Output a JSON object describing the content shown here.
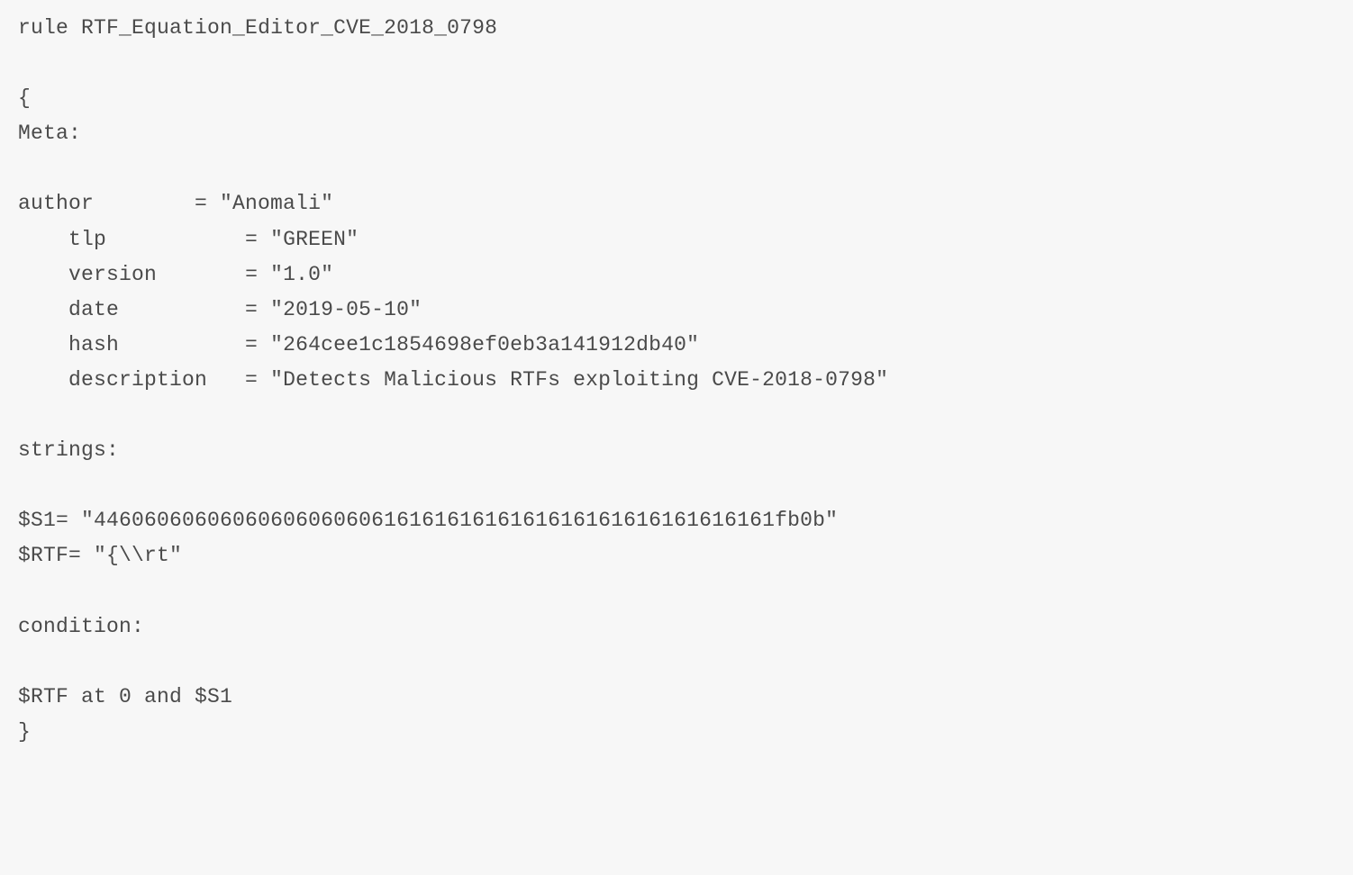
{
  "rule": {
    "keyword_rule": "rule",
    "name": "RTF_Equation_Editor_CVE_2018_0798",
    "open_brace": "{",
    "meta_label": "Meta:",
    "meta": {
      "author": {
        "key": "author",
        "value": "\"Anomali\""
      },
      "tlp": {
        "key": "tlp",
        "value": "\"GREEN\""
      },
      "version": {
        "key": "version",
        "value": "\"1.0\""
      },
      "date": {
        "key": "date",
        "value": "\"2019-05-10\""
      },
      "hash": {
        "key": "hash",
        "value": "\"264cee1c1854698ef0eb3a141912db40\""
      },
      "description": {
        "key": "description",
        "value": "\"Detects Malicious RTFs exploiting CVE-2018-0798\""
      }
    },
    "strings_label": "strings:",
    "strings": {
      "s1": {
        "lhs": "$S1=",
        "value": "\"446060606060606060606061616161616161616161616161616161fb0b\""
      },
      "rtf": {
        "lhs": "$RTF=",
        "value": "\"{\\\\rt\""
      }
    },
    "condition_label": "condition:",
    "condition_expr": "$RTF at 0 and $S1",
    "close_brace": "}"
  }
}
